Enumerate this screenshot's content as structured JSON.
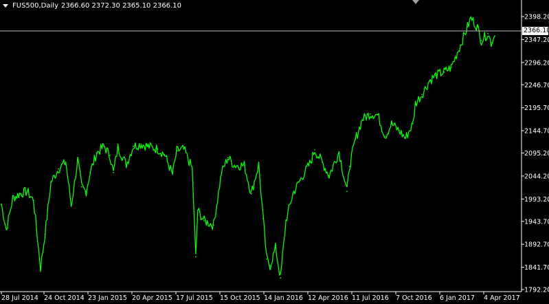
{
  "header": {
    "symbol_tf": "FUS500,Daily",
    "ohlc": "2366.60 2372.30 2365.10 2366.10"
  },
  "price_tag": "2366.10",
  "colors": {
    "background": "#000000",
    "series": "#00ff00",
    "axis": "#ffffff",
    "last_price_line": "#c0c0c0"
  },
  "icons": {
    "menu": "triangle-down-icon",
    "scroll": "chart-shift-marker-icon"
  },
  "chart_data": {
    "type": "line",
    "ylim": [
      1792.2,
      2412.0
    ],
    "y_ticks": [
      "2398.20",
      "2347.20",
      "2296.20",
      "2246.70",
      "2195.70",
      "2144.70",
      "2095.20",
      "2044.20",
      "1993.20",
      "1943.70",
      "1892.70",
      "1841.70",
      "1792.20"
    ],
    "y_tick_values": [
      2398.2,
      2347.2,
      2296.2,
      2246.7,
      2195.7,
      2144.7,
      2095.2,
      2044.2,
      1993.2,
      1943.7,
      1892.7,
      1841.7,
      1792.2
    ],
    "x_ticks": [
      "28 Jul 2014",
      "24 Oct 2014",
      "23 Jan 2015",
      "20 Apr 2015",
      "17 Jul 2015",
      "15 Oct 2015",
      "14 Jan 2016",
      "12 Apr 2016",
      "11 Jul 2016",
      "7 Oct 2016",
      "6 Jan 2017",
      "4 Apr 2017"
    ],
    "x": [
      "2014-07-28",
      "2014-08-07",
      "2014-08-20",
      "2014-09-03",
      "2014-09-18",
      "2014-10-01",
      "2014-10-15",
      "2014-10-24",
      "2014-11-05",
      "2014-11-20",
      "2014-12-05",
      "2014-12-16",
      "2014-12-29",
      "2015-01-06",
      "2015-01-15",
      "2015-01-23",
      "2015-02-05",
      "2015-02-20",
      "2015-03-04",
      "2015-03-11",
      "2015-03-20",
      "2015-04-06",
      "2015-04-20",
      "2015-05-06",
      "2015-05-20",
      "2015-06-08",
      "2015-06-22",
      "2015-07-08",
      "2015-07-17",
      "2015-07-31",
      "2015-08-17",
      "2015-08-24",
      "2015-08-28",
      "2015-09-10",
      "2015-09-29",
      "2015-10-15",
      "2015-10-28",
      "2015-11-10",
      "2015-11-30",
      "2015-12-14",
      "2015-12-29",
      "2016-01-07",
      "2016-01-14",
      "2016-01-21",
      "2016-02-01",
      "2016-02-11",
      "2016-02-22",
      "2016-03-07",
      "2016-03-21",
      "2016-04-12",
      "2016-04-20",
      "2016-05-05",
      "2016-05-19",
      "2016-06-08",
      "2016-06-24",
      "2016-06-29",
      "2016-07-11",
      "2016-07-25",
      "2016-08-10",
      "2016-08-25",
      "2016-09-09",
      "2016-09-22",
      "2016-10-07",
      "2016-10-20",
      "2016-11-04",
      "2016-11-09",
      "2016-11-22",
      "2016-12-07",
      "2016-12-20",
      "2017-01-06",
      "2017-01-20",
      "2017-02-08",
      "2017-02-22",
      "2017-03-01",
      "2017-03-14",
      "2017-03-22",
      "2017-04-04",
      "2017-04-11",
      "2017-04-18"
    ],
    "series": [
      {
        "values": [
          1982,
          1925,
          1995,
          2005,
          2010,
          1990,
          1840,
          1915,
          2030,
          2060,
          2075,
          1978,
          2080,
          2020,
          2010,
          2052,
          2095,
          2110,
          2090,
          2052,
          2108,
          2070,
          2110,
          2115,
          2110,
          2104,
          2092,
          2048,
          2100,
          2104,
          2060,
          1865,
          1968,
          1945,
          1935,
          2052,
          2085,
          2068,
          2068,
          2005,
          2070,
          1950,
          1860,
          1845,
          1885,
          1818,
          1945,
          2005,
          2034,
          2075,
          2102,
          2075,
          2045,
          2098,
          2010,
          2065,
          2125,
          2170,
          2182,
          2180,
          2132,
          2160,
          2145,
          2128,
          2160,
          2205,
          2225,
          2255,
          2268,
          2275,
          2285,
          2335,
          2375,
          2395,
          2375,
          2345,
          2360,
          2340,
          2355
        ]
      }
    ]
  }
}
